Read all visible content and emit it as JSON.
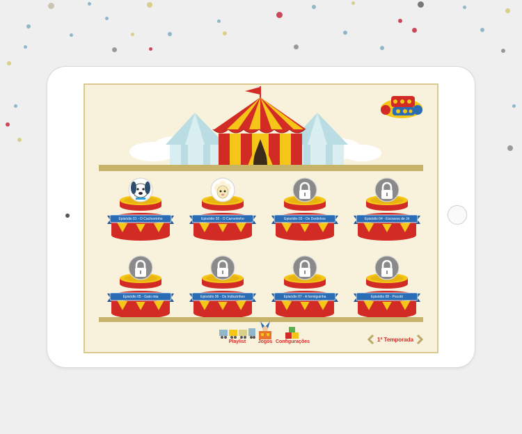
{
  "screen": {
    "episodes": [
      {
        "label": "Episódio 01 - O Cachorrinho",
        "locked": false,
        "character": "dog"
      },
      {
        "label": "Episódio 02 - O Carneirinho",
        "locked": false,
        "character": "sheep"
      },
      {
        "label": "Episódio 03 - Os Dedinhos",
        "locked": true,
        "character": "lock"
      },
      {
        "label": "Episódio 04 - Escravos de Jó",
        "locked": true,
        "character": "lock"
      },
      {
        "label": "Episódio 05 - Gato mia",
        "locked": true,
        "character": "lock"
      },
      {
        "label": "Episódio 06 - Os Indiozinhos",
        "locked": true,
        "character": "lock"
      },
      {
        "label": "Episódio 07 - A formiguinha",
        "locked": true,
        "character": "lock"
      },
      {
        "label": "Episódio 08 - Pocotó",
        "locked": true,
        "character": "lock"
      }
    ],
    "nav": {
      "playlist": "Playlist",
      "jogos": "Jogos",
      "configuracoes": "Configurações"
    },
    "season": {
      "label": "1ª Temporada"
    },
    "colors": {
      "red": "#d22b26",
      "yellow": "#f5c518",
      "blue": "#2a6db5",
      "cream": "#f8f1dc",
      "gold": "#c8b36a"
    },
    "icons": {
      "prev": "chevron-left-icon",
      "next": "chevron-right-icon",
      "lock": "lock-icon"
    }
  }
}
